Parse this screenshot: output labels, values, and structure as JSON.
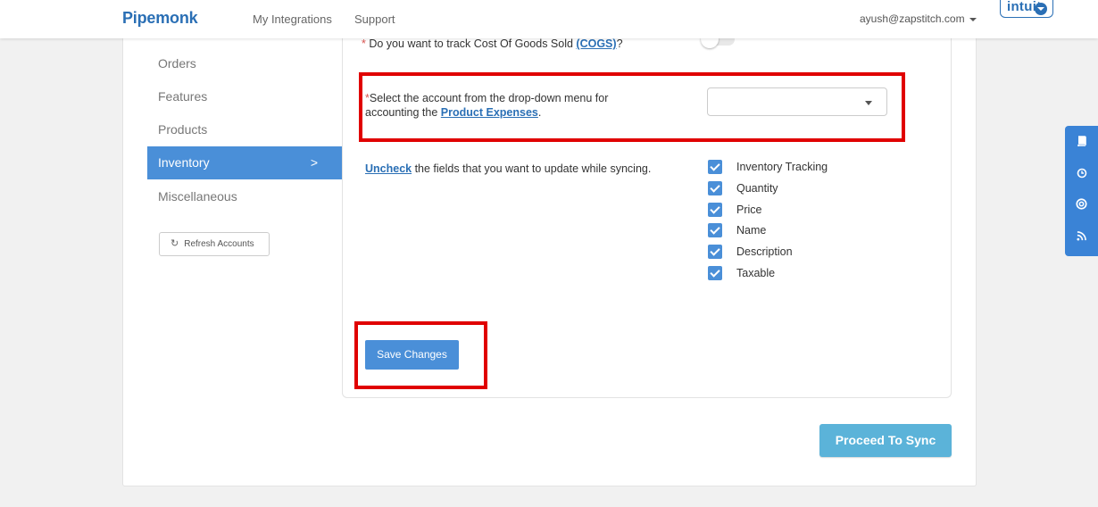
{
  "navbar": {
    "brand": "Pipemonk",
    "links": [
      "My Integrations",
      "Support"
    ],
    "user_email": "ayush@zapstitch.com",
    "intuit_label": "intuit."
  },
  "sidebar": {
    "items": [
      {
        "label": "Orders"
      },
      {
        "label": "Features"
      },
      {
        "label": "Products"
      },
      {
        "label": "Inventory",
        "active": true
      },
      {
        "label": "Miscellaneous"
      }
    ],
    "active_chevron": ">",
    "refresh_label": "Refresh Accounts"
  },
  "settings": {
    "cogs_question_prefix": "Do you want to track Cost Of Goods Sold ",
    "cogs_link": "(COGS)",
    "cogs_question_suffix": "?",
    "cogs_enabled": false,
    "expense_question_line1": "Select the account from the drop-down menu for",
    "expense_question_line2_prefix": "accounting the ",
    "expense_link": "Product Expenses",
    "expense_suffix": ".",
    "expense_selected": "",
    "required_mark": "*",
    "uncheck_link": "Uncheck",
    "uncheck_text": " the fields that you want to update while syncing.",
    "fields": [
      {
        "label": "Inventory Tracking",
        "checked": true
      },
      {
        "label": "Quantity",
        "checked": true
      },
      {
        "label": "Price",
        "checked": true
      },
      {
        "label": "Name",
        "checked": true
      },
      {
        "label": "Description",
        "checked": true
      },
      {
        "label": "Taxable",
        "checked": true
      }
    ],
    "save_label": "Save Changes"
  },
  "footer": {
    "proceed_label": "Proceed To Sync"
  },
  "side_tools": [
    "book-icon",
    "clock-icon",
    "lifebuoy-icon",
    "rss-icon"
  ],
  "colors": {
    "brand": "#2a6fb5",
    "accent": "#4a8fd8",
    "highlight": "#e00000",
    "proceed": "#5bb3d9"
  }
}
